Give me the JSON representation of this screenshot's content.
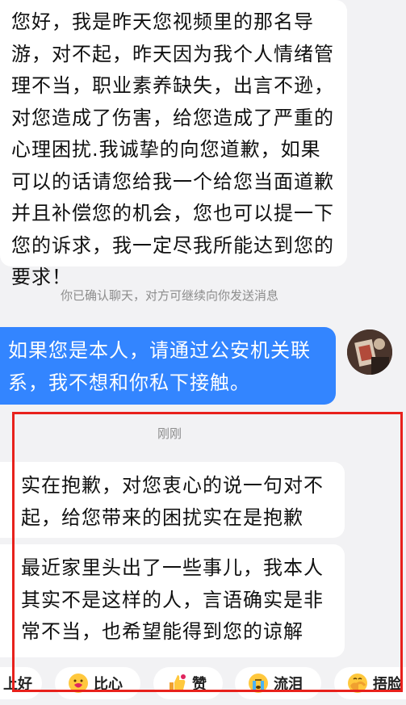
{
  "messages": {
    "first": "您好，我是昨天您视频里的那名导游，对不起，昨天因为我个人情绪管理不当，职业素养缺失，出言不逊，对您造成了伤害，给您造成了严重的心理困扰.我诚挚的向您道歉，如果可以的话请您给我一个给您当面道歉并且补偿您的机会，您也可以提一下您的诉求，我一定尽我所能达到您的要求！",
    "system_note": "你已确认聊天，对方可继续向你发送消息",
    "reply": "如果您是本人，请通过公安机关联系，我不想和你私下接触。",
    "timestamp": "刚刚",
    "second": "实在抱歉，对您衷心的说一句对不起，给您带来的困扰实在是抱歉",
    "third": "最近家里头出了一些事儿，我本人其实不是这样的人，言语确实是非常不当，也希望能得到您的谅解"
  },
  "reactions": [
    {
      "label": "上好",
      "icon": "partial-icon"
    },
    {
      "label": "比心",
      "icon": "heart-hands-emoji-icon"
    },
    {
      "label": "赞",
      "icon": "thumbs-up-emoji-icon"
    },
    {
      "label": "流泪",
      "icon": "crying-emoji-icon"
    },
    {
      "label": "捂脸",
      "icon": "facepalm-emoji-icon"
    }
  ],
  "colors": {
    "accent": "#3385ff",
    "highlight": "#e8211c",
    "background": "#f2f2f4"
  }
}
